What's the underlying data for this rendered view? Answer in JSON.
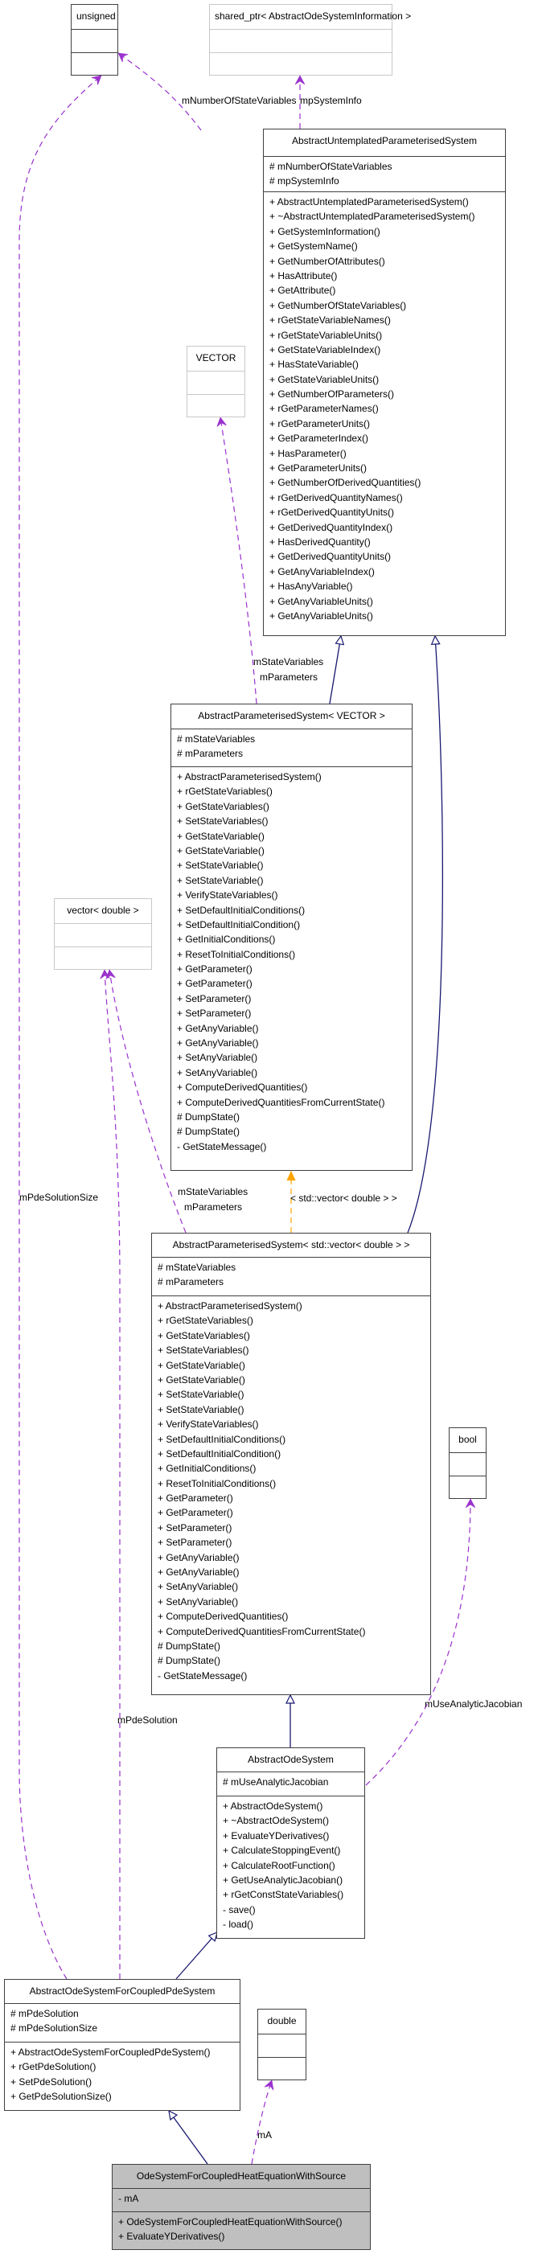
{
  "colors": {
    "inheritance": "#191970",
    "usage": "#9a32cd",
    "template": "#ffa500",
    "box_border": "#404040",
    "external_border": "#c8c8c8",
    "focus_fill": "#bfbfbf"
  },
  "classes": {
    "unsigned": {
      "name": "unsigned",
      "attributes": [],
      "methods": []
    },
    "shared_ptr": {
      "name": "shared_ptr< AbstractOdeSystemInformation >",
      "attributes": [],
      "methods": []
    },
    "untemplated": {
      "name": "AbstractUntemplatedParameterisedSystem",
      "attributes": [
        "# mNumberOfStateVariables",
        "# mpSystemInfo"
      ],
      "methods": [
        "+ AbstractUntemplatedParameterisedSystem()",
        "+ ~AbstractUntemplatedParameterisedSystem()",
        "+ GetSystemInformation()",
        "+ GetSystemName()",
        "+ GetNumberOfAttributes()",
        "+ HasAttribute()",
        "+ GetAttribute()",
        "+ GetNumberOfStateVariables()",
        "+ rGetStateVariableNames()",
        "+ rGetStateVariableUnits()",
        "+ GetStateVariableIndex()",
        "+ HasStateVariable()",
        "+ GetStateVariableUnits()",
        "+ GetNumberOfParameters()",
        "+ rGetParameterNames()",
        "+ rGetParameterUnits()",
        "+ GetParameterIndex()",
        "+ HasParameter()",
        "+ GetParameterUnits()",
        "+ GetNumberOfDerivedQuantities()",
        "+ rGetDerivedQuantityNames()",
        "+ rGetDerivedQuantityUnits()",
        "+ GetDerivedQuantityIndex()",
        "+ HasDerivedQuantity()",
        "+ GetDerivedQuantityUnits()",
        "+ GetAnyVariableIndex()",
        "+ HasAnyVariable()",
        "+ GetAnyVariableUnits()",
        "+ GetAnyVariableUnits()"
      ]
    },
    "vector_tpl": {
      "name": "VECTOR",
      "attributes": [],
      "methods": []
    },
    "param_vector": {
      "name": "AbstractParameterisedSystem< VECTOR >",
      "attributes": [
        "# mStateVariables",
        "# mParameters"
      ],
      "methods": [
        "+ AbstractParameterisedSystem()",
        "+ rGetStateVariables()",
        "+ GetStateVariables()",
        "+ SetStateVariables()",
        "+ GetStateVariable()",
        "+ GetStateVariable()",
        "+ SetStateVariable()",
        "+ SetStateVariable()",
        "+ VerifyStateVariables()",
        "+ SetDefaultInitialConditions()",
        "+ SetDefaultInitialCondition()",
        "+ GetInitialConditions()",
        "+ ResetToInitialConditions()",
        "+ GetParameter()",
        "+ GetParameter()",
        "+ SetParameter()",
        "+ SetParameter()",
        "+ GetAnyVariable()",
        "+ GetAnyVariable()",
        "+ SetAnyVariable()",
        "+ SetAnyVariable()",
        "+ ComputeDerivedQuantities()",
        "+ ComputeDerivedQuantitiesFromCurrentState()",
        "# DumpState()",
        "# DumpState()",
        "- GetStateMessage()"
      ]
    },
    "vector_double": {
      "name": "vector< double >",
      "attributes": [],
      "methods": []
    },
    "param_std_vector": {
      "name": "AbstractParameterisedSystem< std::vector< double > >",
      "attributes": [
        "# mStateVariables",
        "# mParameters"
      ],
      "methods": [
        "+ AbstractParameterisedSystem()",
        "+ rGetStateVariables()",
        "+ GetStateVariables()",
        "+ SetStateVariables()",
        "+ GetStateVariable()",
        "+ GetStateVariable()",
        "+ SetStateVariable()",
        "+ SetStateVariable()",
        "+ VerifyStateVariables()",
        "+ SetDefaultInitialConditions()",
        "+ SetDefaultInitialCondition()",
        "+ GetInitialConditions()",
        "+ ResetToInitialConditions()",
        "+ GetParameter()",
        "+ GetParameter()",
        "+ SetParameter()",
        "+ SetParameter()",
        "+ GetAnyVariable()",
        "+ GetAnyVariable()",
        "+ SetAnyVariable()",
        "+ SetAnyVariable()",
        "+ ComputeDerivedQuantities()",
        "+ ComputeDerivedQuantitiesFromCurrentState()",
        "# DumpState()",
        "# DumpState()",
        "- GetStateMessage()"
      ]
    },
    "bool": {
      "name": "bool",
      "attributes": [],
      "methods": []
    },
    "ode_system": {
      "name": "AbstractOdeSystem",
      "attributes": [
        "# mUseAnalyticJacobian"
      ],
      "methods": [
        "+ AbstractOdeSystem()",
        "+ ~AbstractOdeSystem()",
        "+ EvaluateYDerivatives()",
        "+ CalculateStoppingEvent()",
        "+ CalculateRootFunction()",
        "+ GetUseAnalyticJacobian()",
        "+ rGetConstStateVariables()",
        "- save()",
        "- load()"
      ]
    },
    "coupled_pde": {
      "name": "AbstractOdeSystemForCoupledPdeSystem",
      "attributes": [
        "# mPdeSolution",
        "# mPdeSolutionSize"
      ],
      "methods": [
        "+ AbstractOdeSystemForCoupledPdeSystem()",
        "+ rGetPdeSolution()",
        "+ SetPdeSolution()",
        "+ GetPdeSolutionSize()"
      ]
    },
    "double": {
      "name": "double",
      "attributes": [],
      "methods": []
    },
    "heat_source": {
      "name": "OdeSystemForCoupledHeatEquationWithSource",
      "attributes": [
        "- mA"
      ],
      "methods": [
        "+ OdeSystemForCoupledHeatEquationWithSource()",
        "+ EvaluateYDerivatives()"
      ]
    }
  },
  "edge_labels": {
    "mNumberOfStateVariables": "mNumberOfStateVariables",
    "mpSystemInfo": "mpSystemInfo",
    "vector_tpl_edge_line1": "mStateVariables",
    "vector_tpl_edge_line2": "mParameters",
    "vector_double_edge_line1": "mStateVariables",
    "vector_double_edge_line2": "mParameters",
    "template_binding": "< std::vector< double > >",
    "mPdeSolutionSize": "mPdeSolutionSize",
    "mPdeSolution": "mPdeSolution",
    "mUseAnalyticJacobian": "mUseAnalyticJacobian",
    "mA": "mA"
  }
}
